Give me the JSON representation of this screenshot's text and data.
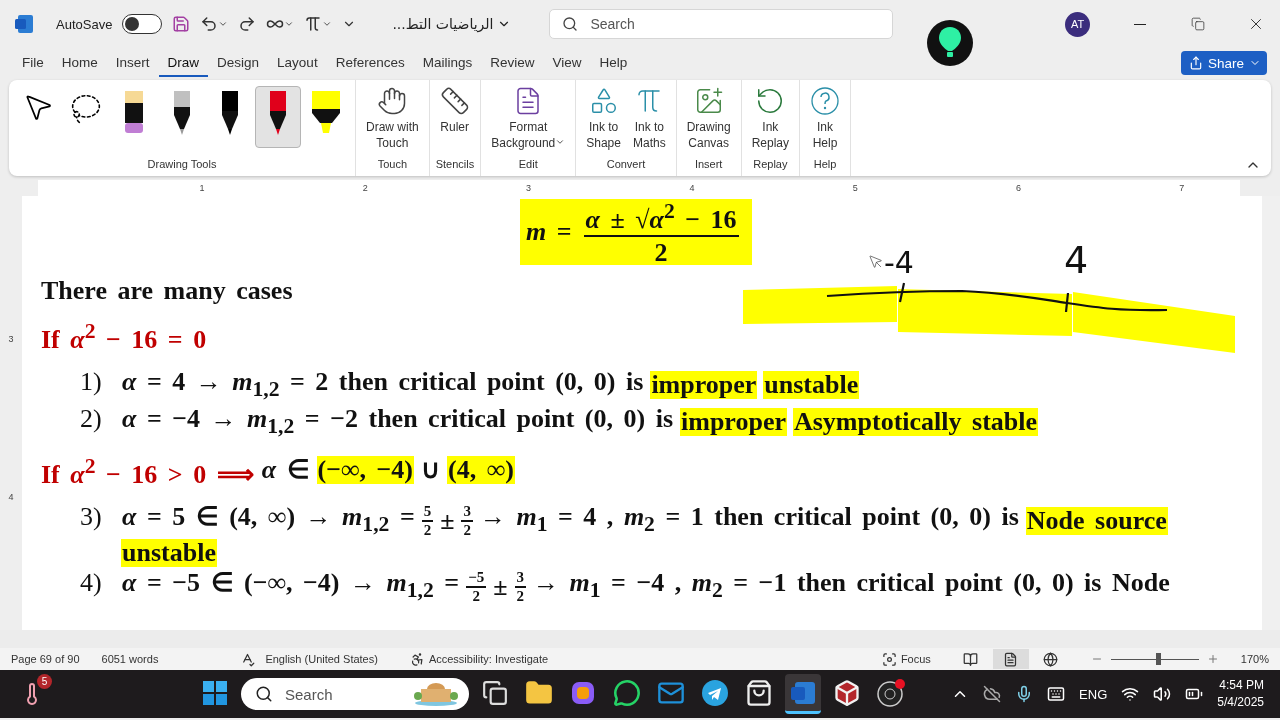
{
  "title_bar": {
    "autosave_label": "AutoSave",
    "autosave_on": false,
    "document_title": "الرياضيات التط...",
    "search": {
      "placeholder": "Search"
    },
    "avatar": "AT"
  },
  "menu_tabs": [
    {
      "label": "File",
      "selected": false
    },
    {
      "label": "Home",
      "selected": false
    },
    {
      "label": "Insert",
      "selected": false
    },
    {
      "label": "Draw",
      "selected": true
    },
    {
      "label": "Design",
      "selected": false
    },
    {
      "label": "Layout",
      "selected": false
    },
    {
      "label": "References",
      "selected": false
    },
    {
      "label": "Mailings",
      "selected": false
    },
    {
      "label": "Review",
      "selected": false
    },
    {
      "label": "View",
      "selected": false
    },
    {
      "label": "Help",
      "selected": false
    }
  ],
  "share_button": "Share",
  "ribbon": {
    "tools_group": "Drawing Tools",
    "tools": [
      {
        "kind": "pointer",
        "selected": false
      },
      {
        "kind": "lasso",
        "selected": false
      },
      {
        "kind": "eraser",
        "selected": false
      },
      {
        "kind": "pencil",
        "selected": false,
        "color": "#c0c0c0"
      },
      {
        "kind": "pen",
        "selected": false,
        "color": "#000000"
      },
      {
        "kind": "pen",
        "selected": true,
        "color": "#e0001b"
      },
      {
        "kind": "highlighter",
        "selected": false,
        "color": "#ffff00"
      }
    ],
    "groups": [
      {
        "label": "Touch",
        "buttons": [
          {
            "kind": "touch",
            "label": "Draw with\nTouch",
            "dropdown": false
          }
        ]
      },
      {
        "label": "Stencils",
        "buttons": [
          {
            "kind": "ruler",
            "label": "Ruler",
            "dropdown": false
          }
        ]
      },
      {
        "label": "Edit",
        "buttons": [
          {
            "kind": "background",
            "label": "Format\nBackground",
            "dropdown": true
          }
        ]
      },
      {
        "label": "Convert",
        "buttons": [
          {
            "kind": "ink-shape",
            "label": "Ink to\nShape",
            "dropdown": false
          },
          {
            "kind": "ink-math",
            "label": "Ink to\nMaths",
            "dropdown": false
          }
        ]
      },
      {
        "label": "Insert",
        "buttons": [
          {
            "kind": "canvas",
            "label": "Drawing\nCanvas",
            "dropdown": false
          }
        ]
      },
      {
        "label": "Replay",
        "buttons": [
          {
            "kind": "replay",
            "label": "Ink\nReplay",
            "dropdown": false
          }
        ]
      },
      {
        "label": "Help",
        "buttons": [
          {
            "kind": "help",
            "label": "Ink\nHelp",
            "dropdown": false
          }
        ]
      }
    ]
  },
  "ruler": {
    "marks": [
      "1",
      "2",
      "3",
      "4",
      "5",
      "6",
      "7"
    ],
    "vertical_marks": [
      "3",
      "4"
    ]
  },
  "document": {
    "formula": {
      "lhs": "*m* =",
      "numerator": "*α* ± √*α*$^{2}$ − 16",
      "denominator": "2",
      "highlighted": true
    },
    "number_line": {
      "labels": [
        "-4",
        "4"
      ]
    },
    "lines": [
      {
        "kind": "heading",
        "segments": [
          {
            "kind": "text",
            "text": "There are many cases",
            "highlighted": false
          }
        ]
      },
      {
        "kind": "condition",
        "segments": [
          {
            "kind": "condition",
            "text": "If *α*$^{2}$ − 16 = 0",
            "highlighted": false
          }
        ]
      },
      {
        "kind": "case",
        "number": "1)",
        "segments": [
          {
            "kind": "text",
            "text": "*α* = 4 → *m*$_{1,2}$ = 2 then critical point (0, 0) is",
            "highlighted": false
          },
          {
            "kind": "text",
            "text": "improper",
            "highlighted": true
          },
          {
            "kind": "text",
            "text": "unstable",
            "highlighted": true
          }
        ]
      },
      {
        "kind": "case",
        "number": "2)",
        "segments": [
          {
            "kind": "text",
            "text": "*α* = −4 → *m*$_{1,2}$ = −2 then critical point (0, 0) is",
            "highlighted": false
          },
          {
            "kind": "text",
            "text": "improper",
            "highlighted": true
          },
          {
            "kind": "text",
            "text": "Asymptotically stable",
            "highlighted": true
          }
        ]
      },
      {
        "kind": "condition",
        "segments": [
          {
            "kind": "condition",
            "text": "If *α*$^{2}$ − 16 > 0 ⟹",
            "highlighted": false
          },
          {
            "kind": "text",
            "text": "*α* ∈",
            "highlighted": false
          },
          {
            "kind": "text",
            "text": "(−∞, −4)",
            "highlighted": true
          },
          {
            "kind": "text",
            "text": "∪",
            "highlighted": false
          },
          {
            "kind": "text",
            "text": "(4, ∞)",
            "highlighted": true
          }
        ]
      },
      {
        "kind": "case",
        "number": "3)",
        "segments": [
          {
            "kind": "text",
            "text": "*α* = 5 ∈ (4, ∞) → *m*$_{1,2}$ =",
            "highlighted": false
          },
          {
            "kind": "fraction",
            "numerator": "5",
            "denominator": "2",
            "highlighted": false
          },
          {
            "kind": "text",
            "text": "±",
            "highlighted": false
          },
          {
            "kind": "fraction",
            "numerator": "3",
            "denominator": "2",
            "highlighted": false
          },
          {
            "kind": "text",
            "text": "→ *m*$_{1}$ = 4 , *m*$_{2}$ = 1 then critical point (0, 0) is",
            "highlighted": false
          },
          {
            "kind": "text",
            "text": "Node source",
            "highlighted": true
          },
          {
            "kind": "text",
            "text": "unstable",
            "highlighted": true
          }
        ]
      },
      {
        "kind": "case",
        "number": "4)",
        "segments": [
          {
            "kind": "text",
            "text": "*α* = −5 ∈ (−∞, −4) → *m*$_{1,2}$ =",
            "highlighted": false
          },
          {
            "kind": "fraction",
            "numerator": "−5",
            "denominator": "2",
            "highlighted": false
          },
          {
            "kind": "text",
            "text": "±",
            "highlighted": false
          },
          {
            "kind": "fraction",
            "numerator": "3",
            "denominator": "2",
            "highlighted": false
          },
          {
            "kind": "text",
            "text": "→ *m*$_{1}$ = −4 , *m*$_{2}$ = −1 then critical point (0, 0) is Node",
            "highlighted": false
          }
        ]
      }
    ]
  },
  "status_bar": {
    "page": "Page 69 of 90",
    "words": "6051 words",
    "language": "English (United States)",
    "accessibility": "Accessibility: Investigate",
    "focus": "Focus",
    "views": [
      {
        "kind": "read",
        "selected": false
      },
      {
        "kind": "print",
        "selected": true
      },
      {
        "kind": "web",
        "selected": false
      }
    ],
    "zoom": {
      "level": 0.54,
      "reading": "170%"
    }
  },
  "taskbar": {
    "weather_badge": "5",
    "search": {
      "placeholder": "Search"
    },
    "apps": [
      {
        "kind": "task-view",
        "selected": false
      },
      {
        "kind": "explorer",
        "selected": false
      },
      {
        "kind": "copilot",
        "selected": false
      },
      {
        "kind": "whatsapp",
        "selected": false
      },
      {
        "kind": "outlook",
        "selected": false
      },
      {
        "kind": "telegram",
        "selected": false
      },
      {
        "kind": "store",
        "selected": false
      },
      {
        "kind": "word",
        "selected": true
      },
      {
        "kind": "box",
        "selected": false
      },
      {
        "kind": "obs",
        "selected": false
      }
    ],
    "language": "ENG",
    "time": "4:54 PM",
    "date": "5/4/2025"
  }
}
